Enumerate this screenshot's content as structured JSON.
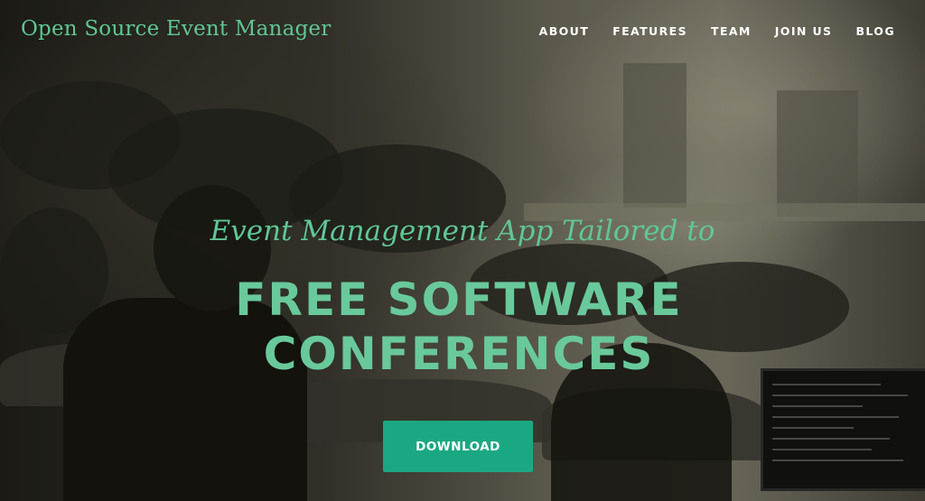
{
  "header": {
    "brand": "Open Source Event Manager",
    "nav": [
      "ABOUT",
      "FEATURES",
      "TEAM",
      "JOIN US",
      "BLOG"
    ]
  },
  "hero": {
    "tagline": "Event Management App Tailored to",
    "headline_line1": "FREE SOFTWARE",
    "headline_line2": "CONFERENCES",
    "cta_label": "DOWNLOAD",
    "background_image": "conference-audience-photo"
  },
  "colors": {
    "accent": "#60c794",
    "headline": "#69c99a",
    "button": "#1aa883",
    "nav_text": "#ffffff"
  }
}
